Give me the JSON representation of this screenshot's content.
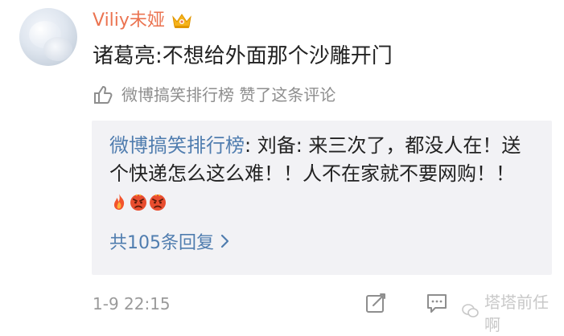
{
  "comment": {
    "username": "Viliy未娅",
    "text": "诸葛亮:不想给外面那个沙雕开门",
    "like_text": "微博搞笑排行榜 赞了这条评论"
  },
  "reply": {
    "author": "微博搞笑排行榜",
    "text": ": 刘备: 来三次了，都没人在！送个快递怎么这么难！！人不在家就不要网购！！",
    "emoji_names": [
      "fire-emoji",
      "angry-face-emoji",
      "angry-face-emoji"
    ],
    "more_replies": "共105条回复"
  },
  "footer": {
    "time": "1-9 22:15",
    "watermark": "塔塔前任啊"
  },
  "colors": {
    "username": "#eb7350",
    "link": "#507daf",
    "muted": "#8e8e8e",
    "reply_bg": "#f2f2f5"
  }
}
